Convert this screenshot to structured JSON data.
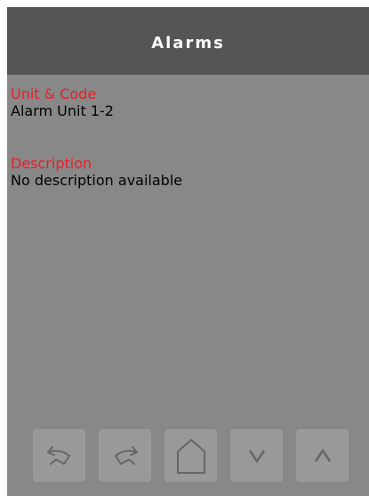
{
  "header": {
    "title": "Alarms"
  },
  "fields": {
    "unit_code": {
      "label": "Unit & Code",
      "value": "Alarm Unit 1-2"
    },
    "description": {
      "label": "Description",
      "value": "No description available"
    }
  },
  "toolbar": {
    "buttons": [
      {
        "icon": "undo-icon"
      },
      {
        "icon": "redo-icon"
      },
      {
        "icon": "home-icon"
      },
      {
        "icon": "chevron-down-icon"
      },
      {
        "icon": "chevron-up-icon"
      }
    ]
  },
  "colors": {
    "header_bg": "#555555",
    "screen_bg": "#888888",
    "label": "#ee1c25",
    "button_bg": "#999999",
    "icon": "#666666"
  }
}
